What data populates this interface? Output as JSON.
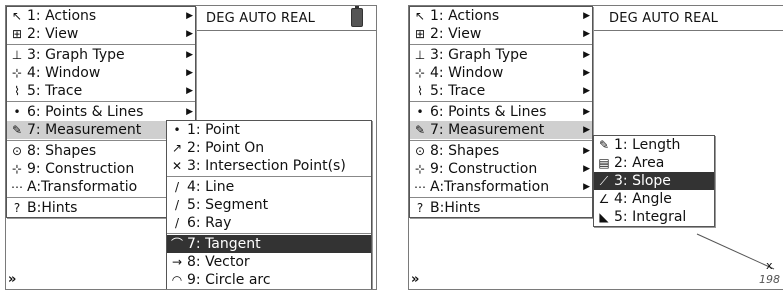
{
  "status": {
    "text": "DEG AUTO REAL"
  },
  "entry_prompt": "»",
  "main_menu": [
    {
      "label": "1: Actions",
      "icon": "pointer-icon",
      "glyph": "↖",
      "submenu": true
    },
    {
      "label": "2: View",
      "icon": "view-icon",
      "glyph": "⊞",
      "submenu": true
    },
    {
      "label": "3: Graph Type",
      "icon": "graph-type-icon",
      "glyph": "⊥",
      "submenu": true
    },
    {
      "label": "4: Window",
      "icon": "window-icon",
      "glyph": "⊹",
      "submenu": true
    },
    {
      "label": "5: Trace",
      "icon": "trace-icon",
      "glyph": "⌇",
      "submenu": true
    },
    {
      "label": "6: Points & Lines",
      "icon": "points-lines-icon",
      "glyph": "•",
      "submenu": true
    },
    {
      "label": "7: Measurement",
      "icon": "measurement-icon",
      "glyph": "✎",
      "submenu": true
    },
    {
      "label": "8: Shapes",
      "icon": "shapes-icon",
      "glyph": "⊙",
      "submenu": true
    },
    {
      "label": "9: Construction",
      "icon": "construction-icon",
      "glyph": "⊹",
      "submenu": true
    },
    {
      "label": "A:Transformatio",
      "icon": "transformation-icon",
      "glyph": "⋯",
      "submenu": true
    },
    {
      "label": "B:Hints",
      "icon": "hints-icon",
      "glyph": "?",
      "submenu": false
    }
  ],
  "main_menu_right_last": "A:Transformation",
  "points_lines_submenu": [
    {
      "label": "1: Point",
      "icon": "point-icon",
      "glyph": "•"
    },
    {
      "label": "2: Point On",
      "icon": "point-on-icon",
      "glyph": "↗"
    },
    {
      "label": "3: Intersection Point(s)",
      "icon": "intersection-icon",
      "glyph": "✕"
    },
    {
      "label": "4: Line",
      "icon": "line-icon",
      "glyph": "/"
    },
    {
      "label": "5: Segment",
      "icon": "segment-icon",
      "glyph": "/"
    },
    {
      "label": "6: Ray",
      "icon": "ray-icon",
      "glyph": "/"
    },
    {
      "label": "7: Tangent",
      "icon": "tangent-icon",
      "glyph": "⌒",
      "selected": true
    },
    {
      "label": "8: Vector",
      "icon": "vector-icon",
      "glyph": "→"
    },
    {
      "label": "9: Circle arc",
      "icon": "circle-arc-icon",
      "glyph": "◠"
    }
  ],
  "measurement_submenu": [
    {
      "label": "1: Length",
      "icon": "length-icon",
      "glyph": "✎"
    },
    {
      "label": "2: Area",
      "icon": "area-icon",
      "glyph": "▤"
    },
    {
      "label": "3: Slope",
      "icon": "slope-icon",
      "glyph": "⟋",
      "selected": true
    },
    {
      "label": "4: Angle",
      "icon": "angle-icon",
      "glyph": "∠"
    },
    {
      "label": "5: Integral",
      "icon": "integral-icon",
      "glyph": "◣"
    }
  ],
  "graph": {
    "axis_label": "x",
    "number": "198"
  }
}
